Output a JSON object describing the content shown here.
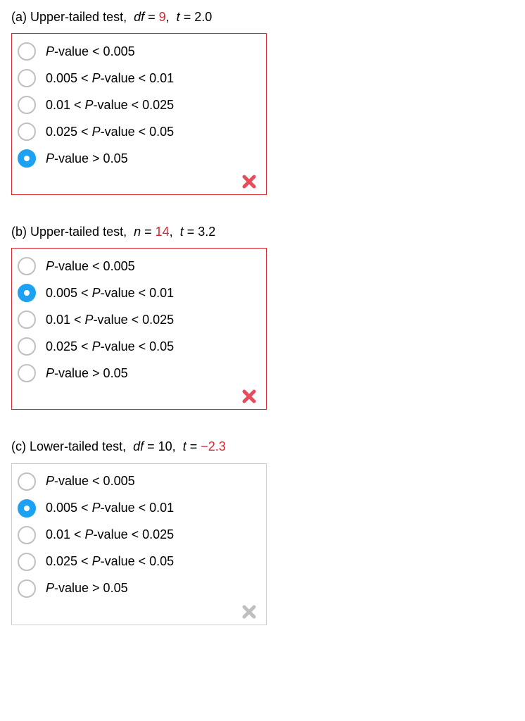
{
  "questions": [
    {
      "id": "a",
      "label": "(a)",
      "test_type": "Upper-tailed test",
      "param_name": "df",
      "param_value": "9",
      "param_value_class": "val-red",
      "stat_name": "t",
      "stat_value": "2.0",
      "stat_value_class": "",
      "box_class": "incorrect",
      "feedback_icon_class": "red",
      "selected_index": 4,
      "options": [
        {
          "pre": "",
          "mid": "P",
          "post": "-value < 0.005"
        },
        {
          "pre": "0.005 < ",
          "mid": "P",
          "post": "-value < 0.01"
        },
        {
          "pre": "0.01 < ",
          "mid": "P",
          "post": "-value < 0.025"
        },
        {
          "pre": "0.025 < ",
          "mid": "P",
          "post": "-value < 0.05"
        },
        {
          "pre": "",
          "mid": "P",
          "post": "-value > 0.05"
        }
      ]
    },
    {
      "id": "b",
      "label": "(b)",
      "test_type": "Upper-tailed test",
      "param_name": "n",
      "param_value": "14",
      "param_value_class": "val-red",
      "stat_name": "t",
      "stat_value": "3.2",
      "stat_value_class": "",
      "box_class": "incorrect",
      "feedback_icon_class": "red",
      "selected_index": 1,
      "options": [
        {
          "pre": "",
          "mid": "P",
          "post": "-value < 0.005"
        },
        {
          "pre": "0.005 < ",
          "mid": "P",
          "post": "-value < 0.01"
        },
        {
          "pre": "0.01 < ",
          "mid": "P",
          "post": "-value < 0.025"
        },
        {
          "pre": "0.025 < ",
          "mid": "P",
          "post": "-value < 0.05"
        },
        {
          "pre": "",
          "mid": "P",
          "post": "-value > 0.05"
        }
      ]
    },
    {
      "id": "c",
      "label": "(c)",
      "test_type": "Lower-tailed test",
      "param_name": "df",
      "param_value": "10",
      "param_value_class": "",
      "stat_name": "t",
      "stat_value": "−2.3",
      "stat_value_class": "val-red",
      "box_class": "",
      "feedback_icon_class": "gray",
      "selected_index": 1,
      "options": [
        {
          "pre": "",
          "mid": "P",
          "post": "-value < 0.005"
        },
        {
          "pre": "0.005 < ",
          "mid": "P",
          "post": "-value < 0.01"
        },
        {
          "pre": "0.01 < ",
          "mid": "P",
          "post": "-value < 0.025"
        },
        {
          "pre": "0.025 < ",
          "mid": "P",
          "post": "-value < 0.05"
        },
        {
          "pre": "",
          "mid": "P",
          "post": "-value > 0.05"
        }
      ]
    }
  ]
}
